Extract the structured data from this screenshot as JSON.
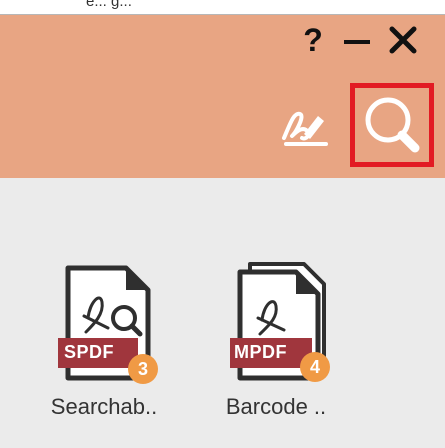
{
  "header": {
    "cut_text": "e... g...",
    "help_glyph": "?",
    "icons": {
      "minimize": "minimize-icon",
      "close": "close-icon",
      "edit": "sign-edit-icon",
      "search": "search-icon"
    },
    "colors": {
      "header_bg": "#e8a583",
      "highlight": "#e21b23"
    }
  },
  "apps": [
    {
      "name": "Searchab..",
      "badge": "SPDF",
      "count": "3",
      "icon": "pdf-search-icon"
    },
    {
      "name": "Barcode ..",
      "badge": "MPDF",
      "count": "4",
      "icon": "pdf-stack-icon"
    }
  ],
  "colors": {
    "badge_red": "#a0363d",
    "count_orange": "#f09a45",
    "body_bg": "#ebebeb"
  }
}
